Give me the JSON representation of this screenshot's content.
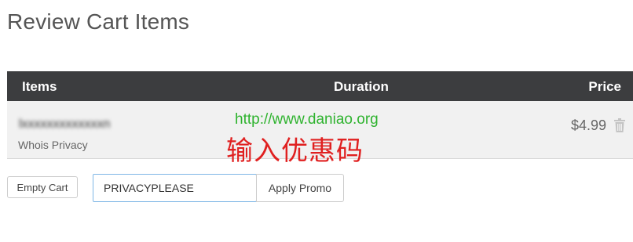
{
  "page": {
    "title": "Review Cart Items"
  },
  "table": {
    "headers": {
      "items": "Items",
      "duration": "Duration",
      "price": "Price"
    },
    "rows": [
      {
        "product_name": "lxxxxxxxxxxxxxn",
        "product_sub": "Whois Privacy",
        "price": "$4.99",
        "delete_icon": "trash-icon"
      }
    ]
  },
  "watermark": {
    "url": "http://www.daniao.org",
    "caption": "输入优惠码"
  },
  "actions": {
    "empty_cart_label": "Empty Cart",
    "promo_code_value": "PRIVACYPLEASE",
    "apply_promo_label": "Apply Promo"
  },
  "colors": {
    "header_bg": "#3c3d3f",
    "row_bg": "#f1f1f1",
    "input_border": "#7fb7e6",
    "watermark_url": "#2fb32f",
    "watermark_caption": "#e02020"
  }
}
